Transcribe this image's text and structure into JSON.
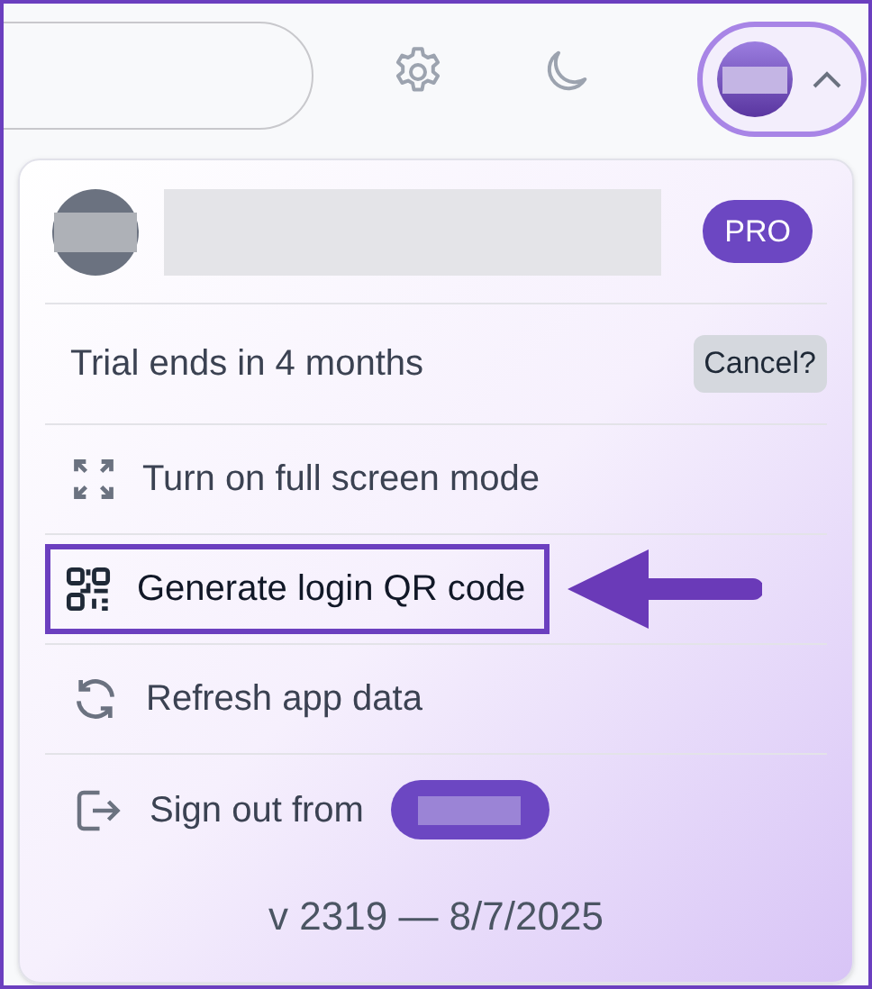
{
  "header": {
    "icons": [
      {
        "kind": "settings"
      },
      {
        "kind": "theme"
      }
    ],
    "account_button": {
      "expanded": true
    }
  },
  "menu": {
    "profile": {
      "badge": "PRO"
    },
    "trial": {
      "text": "Trial ends in 4 months",
      "action": "Cancel?"
    },
    "items": [
      {
        "kind": "expand",
        "label": "Turn on full screen mode",
        "highlighted": false
      },
      {
        "kind": "qr",
        "label": "Generate login QR code",
        "highlighted": true
      },
      {
        "kind": "refresh",
        "label": "Refresh app data",
        "highlighted": false
      },
      {
        "kind": "signout",
        "label": "Sign out from",
        "highlighted": false
      }
    ],
    "version": "v 2319 — 8/7/2025"
  }
}
